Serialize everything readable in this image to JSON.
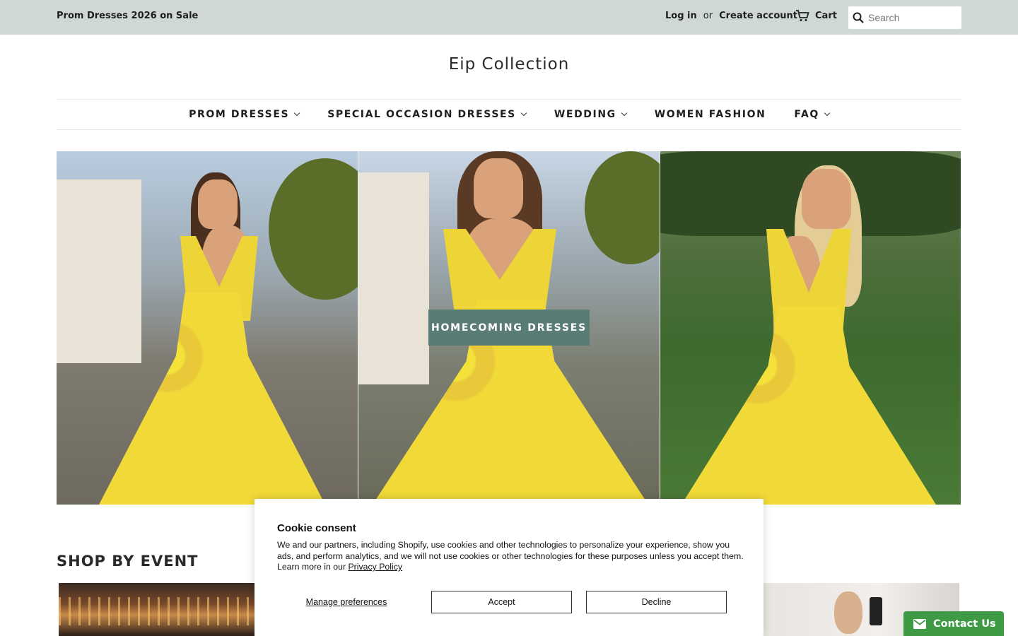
{
  "topbar": {
    "promo": "Prom Dresses 2026 on Sale",
    "login": "Log in",
    "or": "or",
    "create_account": "Create account",
    "cart": "Cart",
    "search_placeholder": "Search"
  },
  "logo": "Eip Collection",
  "nav": {
    "items": [
      {
        "label": "PROM DRESSES",
        "dropdown": true
      },
      {
        "label": "SPECIAL OCCASION DRESSES",
        "dropdown": true
      },
      {
        "label": "WEDDING",
        "dropdown": true
      },
      {
        "label": "WOMEN FASHION",
        "dropdown": false
      },
      {
        "label": "FAQ",
        "dropdown": true
      }
    ]
  },
  "hero": {
    "cta": "HOMECOMING DRESSES"
  },
  "sections": {
    "shop_by_event": "SHOP BY EVENT"
  },
  "cookie": {
    "title": "Cookie consent",
    "body": "We and our partners, including Shopify, use cookies and other technologies to personalize your experience, show you ads, and perform analytics, and we will not use cookies or other technologies for these purposes unless you accept them. Learn more in our",
    "privacy_link": "Privacy Policy",
    "manage": "Manage preferences",
    "accept": "Accept",
    "decline": "Decline"
  },
  "contact": {
    "label": "Contact Us"
  },
  "colors": {
    "topbar_bg": "#cfd8d2",
    "cta_bg": "#5a7c76",
    "contact_bg": "#3f9a46"
  }
}
